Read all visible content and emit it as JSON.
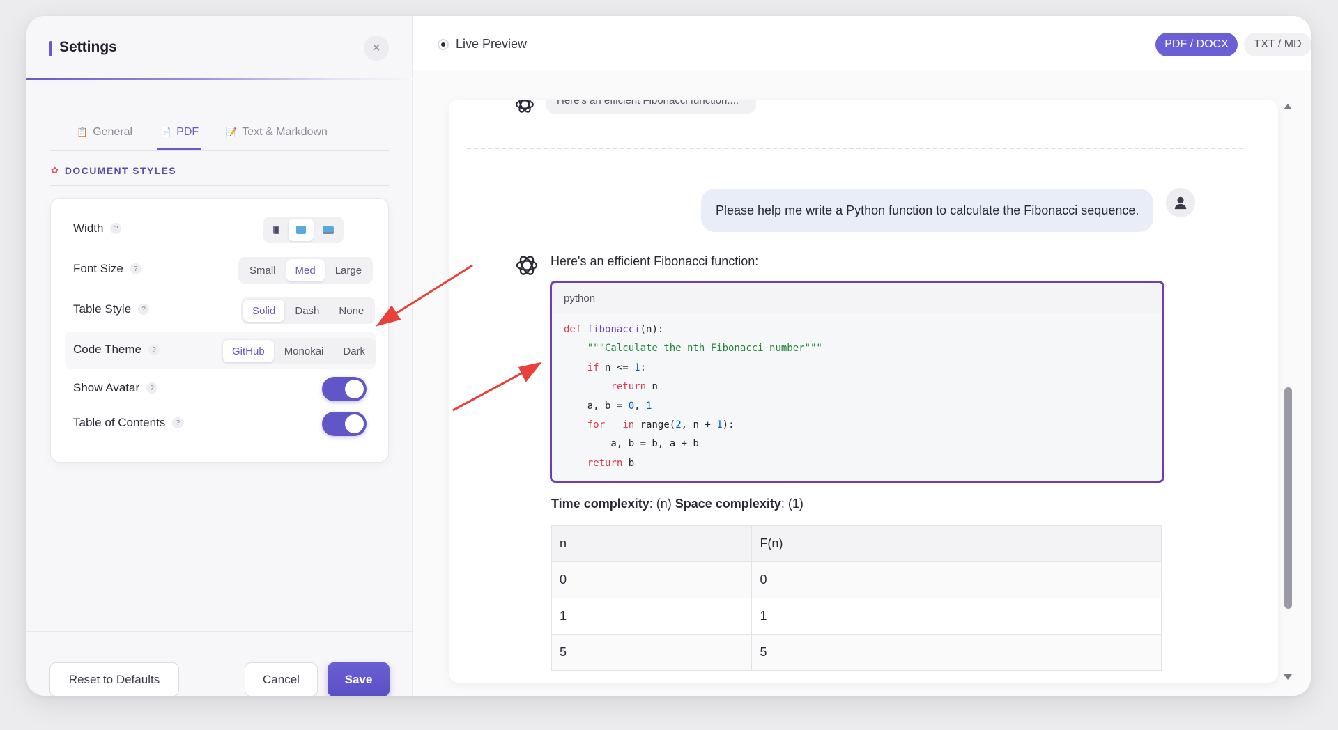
{
  "settings": {
    "title": "Settings",
    "close_icon": "×",
    "tabs": [
      {
        "icon": "📋",
        "label": "General"
      },
      {
        "icon": "📄",
        "label": "PDF"
      },
      {
        "icon": "📝",
        "label": "Text & Markdown"
      }
    ],
    "active_tab": "PDF",
    "section_title": "DOCUMENT STYLES",
    "rows": {
      "width": {
        "label": "Width",
        "options": [
          "narrow-icon",
          "medium-icon",
          "wide-icon"
        ],
        "selected": "medium-icon"
      },
      "font_size": {
        "label": "Font Size",
        "options": [
          "Small",
          "Med",
          "Large"
        ],
        "selected": "Med"
      },
      "table_style": {
        "label": "Table Style",
        "options": [
          "Solid",
          "Dash",
          "None"
        ],
        "selected": "Solid"
      },
      "code_theme": {
        "label": "Code Theme",
        "options": [
          "GitHub",
          "Monokai",
          "Dark"
        ],
        "selected": "GitHub"
      },
      "show_avatar": {
        "label": "Show Avatar",
        "on": true
      },
      "toc": {
        "label": "Table of Contents",
        "on": true
      }
    },
    "help_mark": "?",
    "footer": {
      "reset": "Reset to Defaults",
      "cancel": "Cancel",
      "save": "Save"
    }
  },
  "preview": {
    "title": "Live Preview",
    "formats": [
      "PDF / DOCX",
      "TXT / MD"
    ],
    "active_format": "PDF / DOCX",
    "ghost_message": "Here's an efficient Fibonacci function....",
    "user_message": "Please help me write a Python function to calculate the Fibonacci sequence.",
    "ai_intro": "Here's an efficient Fibonacci function:",
    "code_lang": "python",
    "complexity": {
      "time_label": "Time complexity",
      "time_value": ": (n) ",
      "space_label": "Space complexity",
      "space_value": ": (1)"
    },
    "table": {
      "headers": [
        "n",
        "F(n)"
      ],
      "rows": [
        [
          "0",
          "0"
        ],
        [
          "1",
          "1"
        ],
        [
          "5",
          "5"
        ]
      ]
    }
  },
  "colors": {
    "accent": "#6b58c9",
    "code_border": "#6b3fb3",
    "arrow": "#e8403a"
  }
}
